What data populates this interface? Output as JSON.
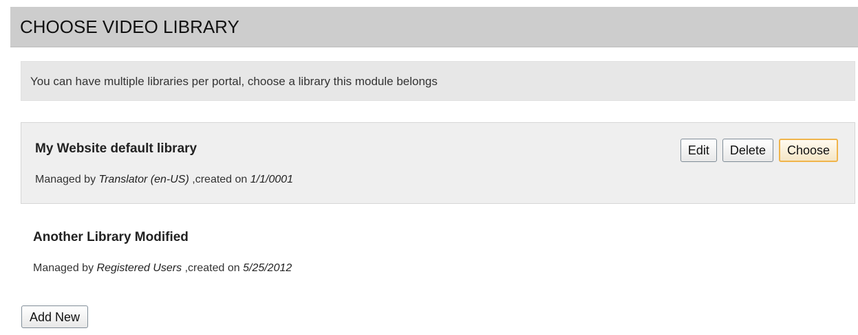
{
  "header": {
    "title": "CHOOSE VIDEO LIBRARY"
  },
  "info": {
    "text": "You can have multiple libraries per portal, choose a library this module belongs"
  },
  "libraries": [
    {
      "name": "My Website default library",
      "managed_prefix": "Managed by",
      "manager": "Translator (en-US)",
      "created_prefix": ",created on",
      "created": "1/1/0001",
      "selected": true,
      "actions": {
        "edit": "Edit",
        "delete": "Delete",
        "choose": "Choose"
      }
    },
    {
      "name": "Another Library Modified",
      "managed_prefix": "Managed by",
      "manager": "Registered Users",
      "created_prefix": ",created on",
      "created": "5/25/2012",
      "selected": false
    }
  ],
  "footer": {
    "add_new_label": "Add New"
  },
  "colors": {
    "header_bg": "#cdcdcd",
    "info_bg": "#e7e7e7",
    "selected_bg": "#efefef",
    "primary_button_border": "#f0b44a"
  }
}
